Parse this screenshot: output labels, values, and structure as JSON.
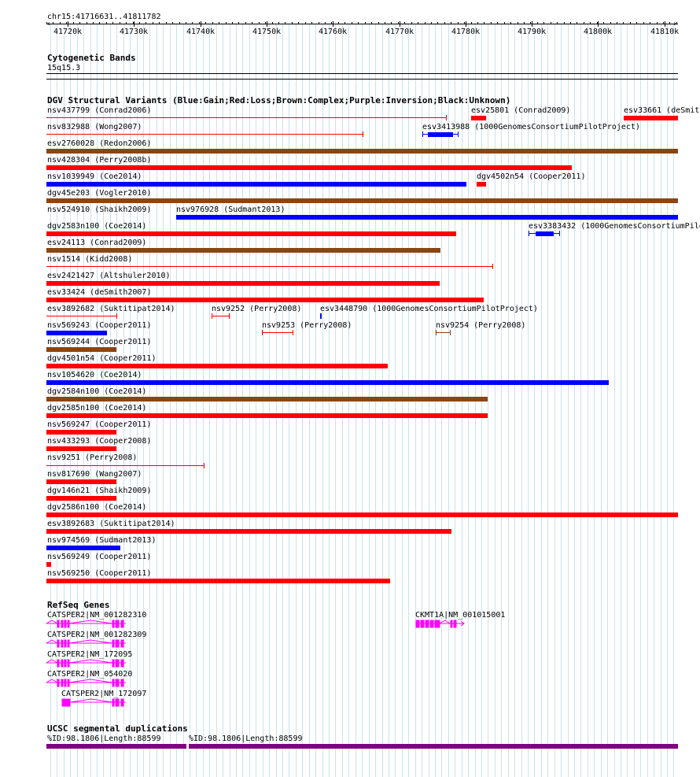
{
  "ruler": {
    "position": "chr15:41716631..41811782",
    "ticks": [
      "41720k",
      "41730k",
      "41740k",
      "41750k",
      "41760k",
      "41770k",
      "41780k",
      "41790k",
      "41800k",
      "41810k"
    ]
  },
  "colors": {
    "gain": "#0000ff",
    "loss": "#ff0000",
    "complex": "#8b4513",
    "purple": "#800080",
    "gene": "#ff00ff",
    "grid": "#c9e2ee"
  },
  "cyto": {
    "title": "Cytogenetic Bands",
    "band": "15q15.3"
  },
  "dgv": {
    "title": "DGV Structural Variants (Blue:Gain;Red:Loss;Brown:Complex;Purple:Inversion;Black:Unknown)",
    "labels": [
      "nsv437799 (Conrad2006)",
      "esv25801 (Conrad2009)",
      "esv33661 (deSmith",
      "nsv832988 (Wong2007)",
      "esv3413988 (1000GenomesConsortiumPilotProject)",
      "esv2760028 (Redon2006)",
      "nsv428304 (Perry2008b)",
      "nsv1039949 (Coe2014)",
      "dgv4502n54 (Cooper2011)",
      "dgv45e203 (Vogler2010)",
      "nsv524910 (Shaikh2009)",
      "nsv976928 (Sudmant2013)",
      "dgv2583n100 (Coe2014)",
      "esv3383432 (1000GenomesConsortiumPilo",
      "esv24113 (Conrad2009)",
      "nsv1514 (Kidd2008)",
      "esv2421427 (Altshuler2010)",
      "esv33424 (deSmith2007)",
      "esv3892682 (Suktitipat2014)",
      "nsv9252 (Perry2008)",
      "esv3448790 (1000GenomesConsortiumPilotProject)",
      "nsv569243 (Cooper2011)",
      "nsv9253 (Perry2008)",
      "nsv9254 (Perry2008)",
      "nsv569244 (Cooper2011)",
      "dgv4501n54 (Cooper2011)",
      "nsv1054620 (Coe2014)",
      "dgv2584n100 (Coe2014)",
      "dgv2585n100 (Coe2014)",
      "nsv569247 (Cooper2011)",
      "nsv433293 (Cooper2008)",
      "nsv9251 (Perry2008)",
      "nsv817690 (Wang2007)",
      "dgv146n21 (Shaikh2009)",
      "dgv2586n100 (Coe2014)",
      "esv3892683 (Suktitipat2014)",
      "nsv974569 (Sudmant2013)",
      "nsv569249 (Cooper2011)",
      "nsv569250 (Cooper2011)"
    ]
  },
  "refseq": {
    "title": "RefSeq Genes",
    "genes": [
      "CATSPER2|NM_001282310",
      "CKMT1A|NM_001015001",
      "CATSPER2|NM_001282309",
      "CATSPER2|NM_172095",
      "CATSPER2|NM_054020",
      "CATSPER2|NM_172097"
    ]
  },
  "segdup": {
    "title": "UCSC segmental duplications",
    "labels": [
      "%ID:98.1806|Length:88599",
      "%ID:98.1806|Length:88599"
    ]
  }
}
